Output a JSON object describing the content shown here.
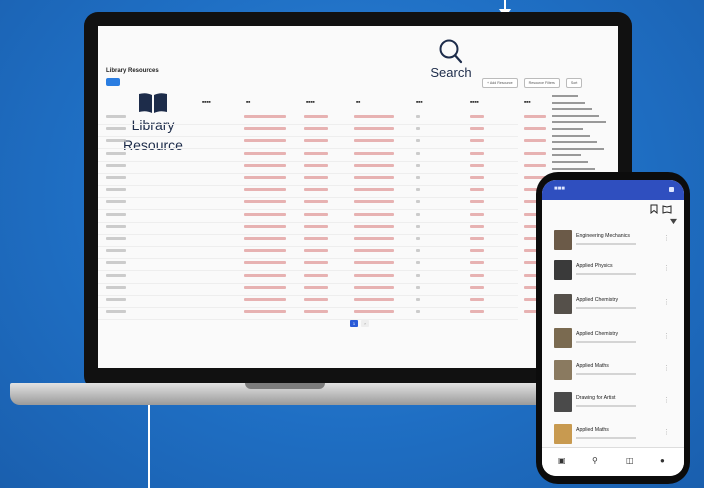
{
  "laptop": {
    "app_title": "Library Resources",
    "search": {
      "label": "Search",
      "icon": "search-icon"
    },
    "library": {
      "label_line1": "Library",
      "label_line2": "Resource",
      "icon": "book-icon"
    },
    "toolbar": [
      {
        "label": "+ Add Resource"
      },
      {
        "label": "Resource Filters"
      },
      {
        "label": "Sort"
      }
    ],
    "pagination": {
      "current": "1"
    }
  },
  "phone": {
    "items": [
      {
        "title": "Engineering Mechanics"
      },
      {
        "title": "Applied Physics"
      },
      {
        "title": "Applied Chemistry"
      },
      {
        "title": "Applied Chemistry"
      },
      {
        "title": "Applied Maths"
      },
      {
        "title": "Drawing for Artist"
      },
      {
        "title": "Applied Maths"
      }
    ]
  },
  "colors": {
    "background": "#1f6fc4",
    "accent": "#2a5bd7",
    "phone_header": "#2f4fbf"
  }
}
